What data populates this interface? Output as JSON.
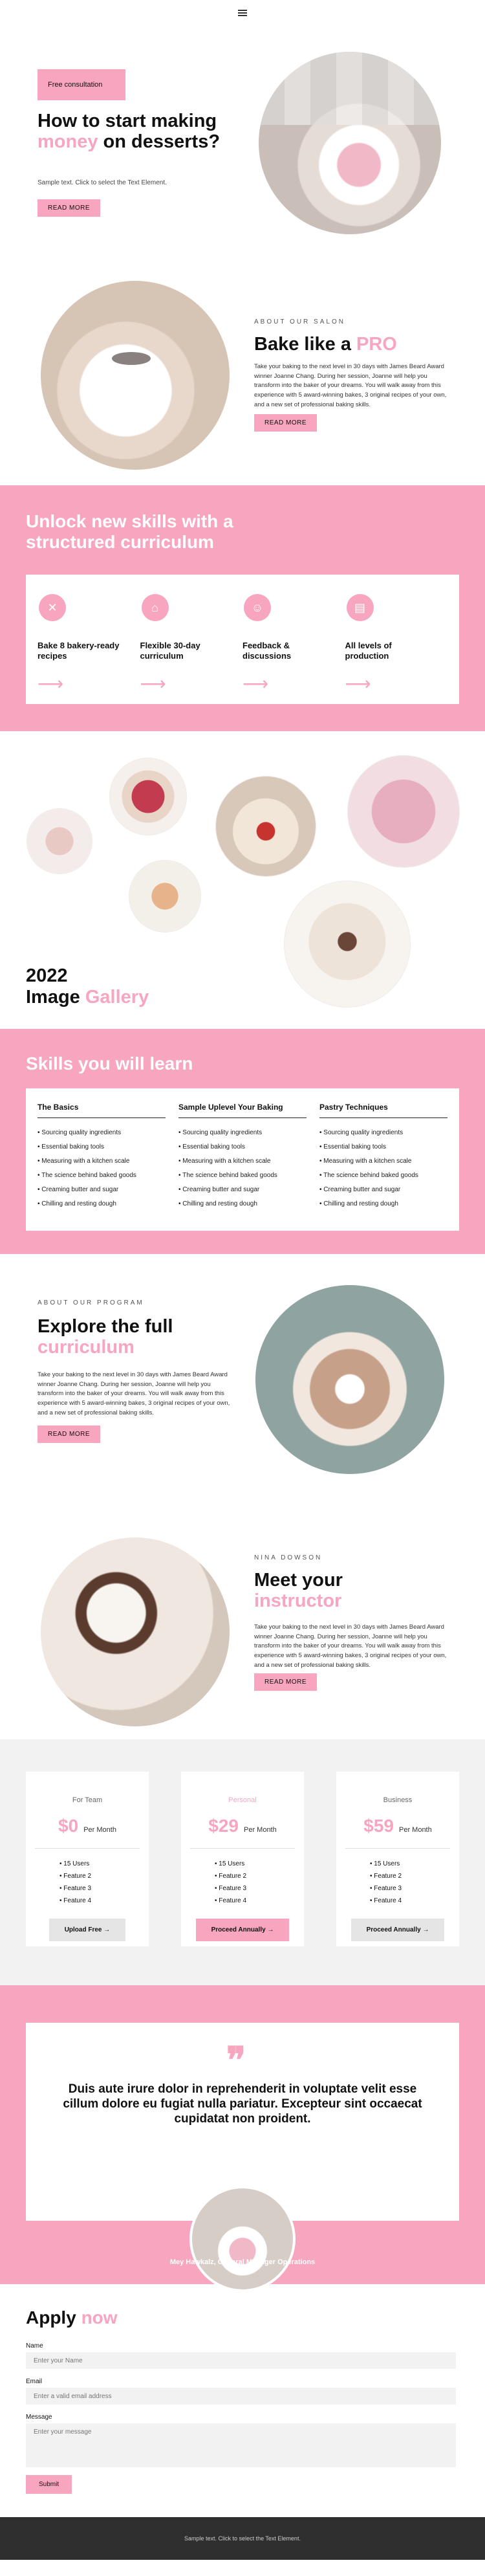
{
  "header": {
    "menu_icon": "hamburger-icon"
  },
  "hero": {
    "tag": "Free consultation",
    "title_a": "How to start making ",
    "title_pink": "money",
    "title_b": " on desserts?",
    "sample": "Sample text. Click to select the Text Element.",
    "button": "READ MORE"
  },
  "about": {
    "eyebrow": "ABOUT OUR SALON",
    "title_a": "Bake like a ",
    "title_pink": "PRO",
    "text": "Take your baking to the next level in 30 days with James Beard Award winner Joanne Chang. During her session, Joanne will help you transform into the baker of your dreams. You will walk away from this experience with 5 award-winning bakes, 3 original recipes of your own, and a new set of professional baking skills.",
    "button": "READ MORE"
  },
  "curriculum": {
    "title": "Unlock new skills with a structured curriculum",
    "cards": [
      {
        "icon": "whisk-icon",
        "glyph": "✕",
        "label": "Bake 8 bakery-ready recipes"
      },
      {
        "icon": "calendar-icon",
        "glyph": "⌂",
        "label": "Flexible 30-day curriculum"
      },
      {
        "icon": "feedback-icon",
        "glyph": "☺",
        "label": "Feedback & discussions"
      },
      {
        "icon": "levels-icon",
        "glyph": "▤",
        "label": "All levels of production"
      }
    ],
    "arrow": "⟶"
  },
  "gallery": {
    "title_a": "2022",
    "title_b": "Image ",
    "title_pink": "Gallery"
  },
  "skills": {
    "title": "Skills you will learn",
    "columns": [
      {
        "heading": "The Basics",
        "items": [
          "Sourcing quality ingredients",
          "Essential baking tools",
          "Measuring with a kitchen scale",
          "The science behind baked goods",
          "Creaming butter and sugar",
          "Chilling and resting dough"
        ]
      },
      {
        "heading": "Sample Uplevel Your Baking",
        "items": [
          "Sourcing quality ingredients",
          "Essential baking tools",
          "Measuring with a kitchen scale",
          "The science behind baked goods",
          "Creaming butter and sugar",
          "Chilling and resting dough"
        ]
      },
      {
        "heading": "Pastry Techniques",
        "items": [
          "Sourcing quality ingredients",
          "Essential baking tools",
          "Measuring with a kitchen scale",
          "The science behind baked goods",
          "Creaming butter and sugar",
          "Chilling and resting dough"
        ]
      }
    ]
  },
  "program": {
    "eyebrow": "ABOUT OUR PROGRAM",
    "title_a": "Explore the full ",
    "title_pink": "curriculum",
    "text": "Take your baking to the next level in 30 days with James Beard Award winner Joanne Chang. During her session, Joanne will help you transform into the baker of your dreams. You will walk away from this experience with 5 award-winning bakes, 3 original recipes of your own, and a new set of professional baking skills.",
    "button": "READ MORE"
  },
  "instructor": {
    "eyebrow": "NINA DOWSON",
    "title_a": "Meet your ",
    "title_pink": "instructor",
    "text": "Take your baking to the next level in 30 days with James Beard Award winner Joanne Chang. During her session, Joanne will help you transform into the baker of your dreams. You will walk away from this experience with 5 award-winning bakes, 3 original recipes of your own, and a new set of professional baking skills.",
    "button": "READ MORE"
  },
  "pricing": {
    "plans": [
      {
        "name": "For Team",
        "amount": "$0",
        "per": "Per Month",
        "features": [
          "15 Users",
          "Feature 2",
          "Feature 3",
          "Feature 4"
        ],
        "button": "Upload Free →"
      },
      {
        "name": "Personal",
        "amount": "$29",
        "per": "Per Month",
        "features": [
          "15 Users",
          "Feature 2",
          "Feature 3",
          "Feature 4"
        ],
        "button": "Proceed Annually →"
      },
      {
        "name": "Business",
        "amount": "$59",
        "per": "Per Month",
        "features": [
          "15 Users",
          "Feature 2",
          "Feature 3",
          "Feature 4"
        ],
        "button": "Proceed Annually →"
      }
    ]
  },
  "testimonial": {
    "quote_mark": "❞",
    "text": "Duis aute irure dolor in reprehenderit in voluptate velit esse cillum dolore eu fugiat nulla pariatur. Excepteur sint occaecat cupidatat non proident.",
    "author": "Mey Hawkalz, General Manager Operations"
  },
  "apply": {
    "title_a": "Apply ",
    "title_pink": "now",
    "name_label": "Name",
    "name_placeholder": "Enter your Name",
    "email_label": "Email",
    "email_placeholder": "Enter a valid email address",
    "message_label": "Message",
    "message_placeholder": "Enter your message",
    "submit": "Submit"
  },
  "footer": {
    "text": "Sample text. Click to select the Text Element."
  },
  "colors": {
    "accent": "#f8a5bf",
    "footer_bg": "#2f2f2f",
    "pricing_bg": "#f2f2f2"
  }
}
